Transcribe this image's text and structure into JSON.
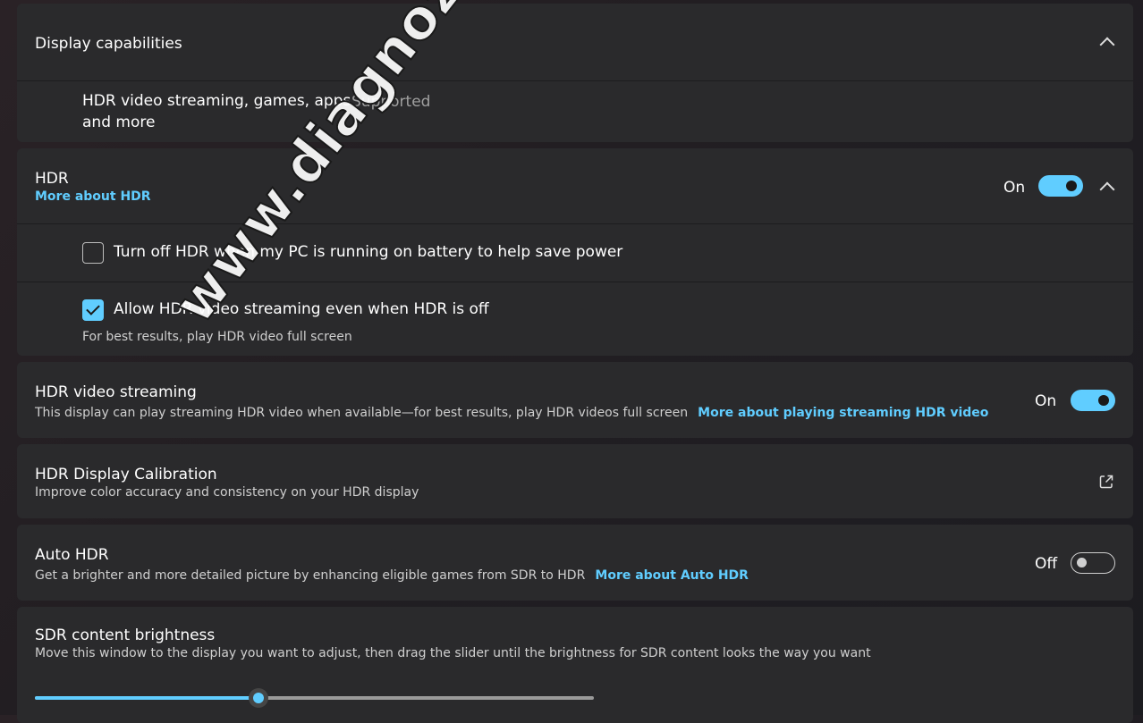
{
  "display_capabilities": {
    "title": "Display capabilities",
    "hdr_label_line1": "HDR video streaming, games, apps",
    "hdr_label_line2": "and more",
    "hdr_value": "Supported"
  },
  "hdr": {
    "title": "HDR",
    "link": "More about HDR",
    "state": "On",
    "battery_checkbox_label": "Turn off HDR when my PC is running on battery to help save power",
    "battery_checked": false,
    "allow_checkbox_label": "Allow HDR video streaming even when HDR is off",
    "allow_checked": true,
    "allow_hint": "For best results, play HDR video full screen"
  },
  "hdr_video_streaming": {
    "title": "HDR video streaming",
    "desc": "This display can play streaming HDR video when available—for best results, play HDR videos full screen",
    "link": "More about playing streaming HDR video",
    "state": "On"
  },
  "calibration": {
    "title": "HDR Display Calibration",
    "desc": "Improve color accuracy and consistency on your HDR display"
  },
  "auto_hdr": {
    "title": "Auto HDR",
    "desc": "Get a brighter and more detailed picture by enhancing eligible games from SDR to HDR",
    "link": "More about Auto HDR",
    "state": "Off"
  },
  "sdr_brightness": {
    "title": "SDR content brightness",
    "desc": "Move this window to the display you want to adjust, then drag the slider until the brightness for SDR content looks the way you want",
    "value_fraction": 0.4
  },
  "watermark": "www.diagnozabam.ro",
  "colors": {
    "accent": "#60cdff",
    "card": "#2a2a2c",
    "background": "#1f1d22"
  }
}
